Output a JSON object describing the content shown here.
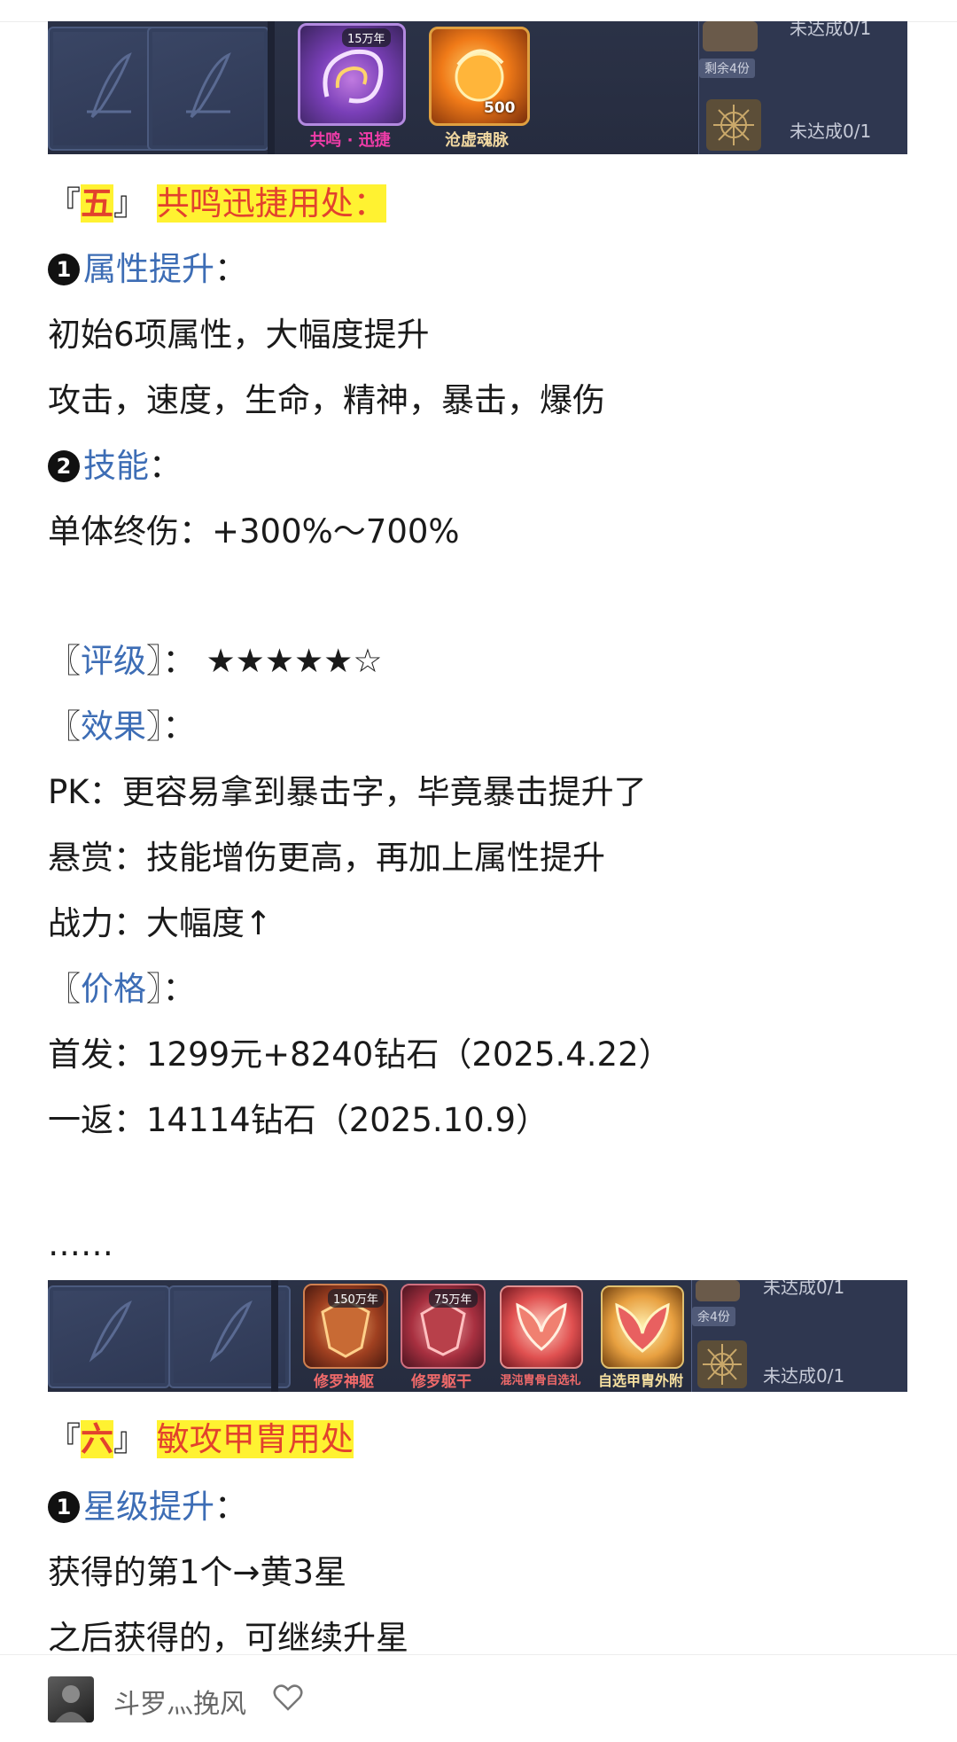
{
  "banner1": {
    "items": [
      {
        "label": "共鸣 · 迅捷",
        "badge": "15万年",
        "label_color": "#f03ca8"
      },
      {
        "label": "沧虚魂脉",
        "count": "500",
        "label_color": "#f0d7a0"
      }
    ],
    "right_status_1": "未达成0/1",
    "right_status_2": "未达成0/1",
    "remaining": "剩余4份"
  },
  "section5": {
    "title_prefix": "『",
    "title_num": "五",
    "title_suffix": "』",
    "title_text": "共鸣迅捷用处：",
    "h1_num": "1",
    "h1_label": "属性提升",
    "h1_colon": "：",
    "l1": "初始6项属性，大幅度提升",
    "l2": "攻击，速度，生命，精神，暴击，爆伤",
    "h2_num": "2",
    "h2_label": "技能",
    "h2_colon": "：",
    "l3": "单体终伤：+300%～700%",
    "rating_open": "〖",
    "rating_label": "评级",
    "rating_close": "〗：",
    "rating_stars": "★★★★★☆",
    "effect_open": "〖",
    "effect_label": "效果",
    "effect_close": "〗：",
    "l4": "PK：更容易拿到暴击字，毕竟暴击提升了",
    "l5": "悬赏：技能增伤更高，再加上属性提升",
    "l6": "战力：大幅度↑",
    "price_open": "〖",
    "price_label": "价格",
    "price_close": "〗：",
    "l7": "首发：1299元+8240钻石（2025.4.22）",
    "l8": "一返：14114钻石（2025.10.9）",
    "ellipsis": "……"
  },
  "banner2": {
    "items": [
      {
        "label": "修罗神躯",
        "badge": "150万年"
      },
      {
        "label": "修罗躯干",
        "badge": "75万年"
      },
      {
        "label": "混沌胄骨自选礼",
        "badge": ""
      },
      {
        "label": "自选甲胄外附",
        "badge": ""
      }
    ],
    "right_status_1": "未达成0/1",
    "right_status_2": "未达成0/1",
    "remaining": "余4份"
  },
  "section6": {
    "title_prefix": "『",
    "title_num": "六",
    "title_suffix": "』",
    "title_text": "敏攻甲胄用处",
    "h1_num": "1",
    "h1_label": "星级提升",
    "h1_colon": "：",
    "l1": "获得的第1个→黄3星",
    "l2": "之后获得的，可继续升星"
  },
  "footer": {
    "author": "斗罗灬挽风"
  },
  "colors": {
    "highlight": "#fff231",
    "accent_red": "#e2422d",
    "link_blue": "#3d6db5"
  }
}
